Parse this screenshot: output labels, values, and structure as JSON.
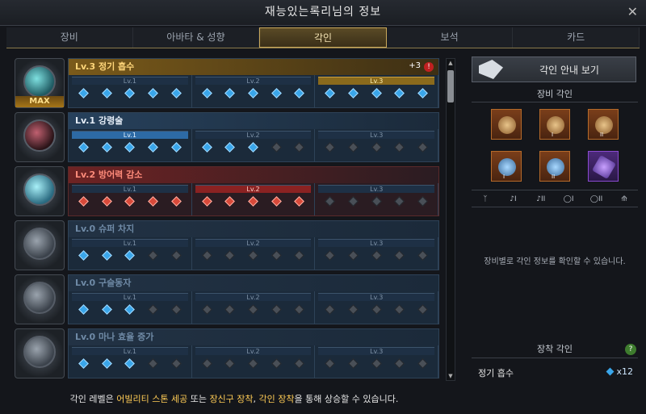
{
  "window": {
    "title": "재능있는록리님의 정보"
  },
  "tabs": [
    {
      "label": "장비"
    },
    {
      "label": "아바타 & 성향"
    },
    {
      "label": "각인"
    },
    {
      "label": "보석"
    },
    {
      "label": "카드"
    }
  ],
  "engravings": [
    {
      "title": "Lv.3 정기 흡수",
      "bonus": "+3",
      "max_badge": "MAX",
      "levels": [
        "Lv.1",
        "Lv.2",
        "Lv.3"
      ]
    },
    {
      "title": "Lv.1 강령술",
      "levels": [
        "Lv.1",
        "Lv.2",
        "Lv.3"
      ]
    },
    {
      "title": "Lv.2 방어력 감소",
      "levels": [
        "Lv.1",
        "Lv.2",
        "Lv.3"
      ]
    },
    {
      "title": "Lv.0 슈퍼 차지",
      "levels": [
        "Lv.1",
        "Lv.2",
        "Lv.3"
      ]
    },
    {
      "title": "Lv.0 구슬동자",
      "levels": [
        "Lv.1",
        "Lv.2",
        "Lv.3"
      ]
    },
    {
      "title": "Lv.0 마나 효율 증가",
      "levels": [
        "Lv.1",
        "Lv.2",
        "Lv.3"
      ]
    }
  ],
  "footer": {
    "prefix": "각인 레벨은 ",
    "hl1": "어빌리티 스톤 세공",
    "mid1": " 또는 ",
    "hl2": "장신구 장착",
    "mid2": ", ",
    "hl3": "각인 장착",
    "suffix": "을 통해 상승할 수 있습니다."
  },
  "side": {
    "guide_label": "각인 안내 보기",
    "equip_title": "장비 각인",
    "equip_numerals": [
      "",
      "I",
      "II",
      "I",
      "II",
      ""
    ],
    "slot_labels": [
      "",
      "I",
      "II",
      "I",
      "II",
      ""
    ],
    "message": "장비별로 각인 정보를 확인할 수 있습니다.",
    "equipped_title": "장착 각인",
    "help_label": "?",
    "equipped": {
      "name": "정기 흡수",
      "count": "x12"
    }
  },
  "colors": {
    "gold": "#ffd67a",
    "blue": "#3aa6ea",
    "red": "#d84a3a",
    "accent": "#c9a85a"
  }
}
